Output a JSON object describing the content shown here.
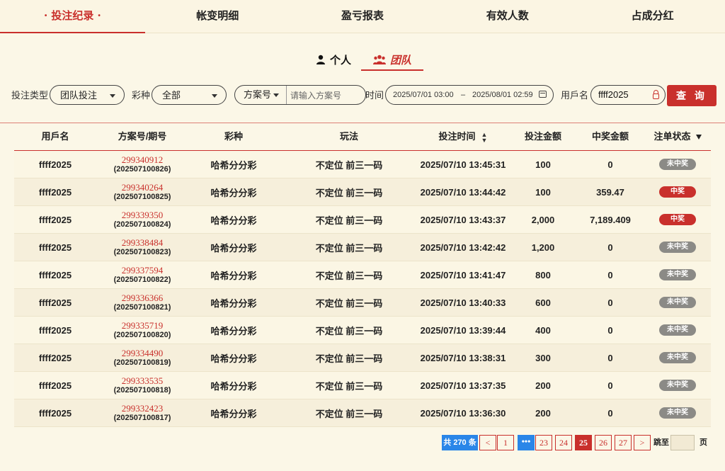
{
  "top_tabs": [
    {
      "label": "投注纪录",
      "active": true
    },
    {
      "label": "帐变明细"
    },
    {
      "label": "盈亏报表"
    },
    {
      "label": "有效人数"
    },
    {
      "label": "占成分红"
    }
  ],
  "sub_tabs": {
    "personal": "个人",
    "team": "团队"
  },
  "filters": {
    "bet_type_label": "投注类型",
    "bet_type_value": "团队投注",
    "lottery_label": "彩种",
    "lottery_value": "全部",
    "scheme_select": "方案号",
    "scheme_placeholder": "请输入方案号",
    "time_label": "时间",
    "date_start": "2025/07/01 03:00",
    "date_sep": "–",
    "date_end": "2025/08/01 02:59",
    "user_label": "用戶名",
    "user_value": "ffff2025",
    "query_button": "查 询"
  },
  "table": {
    "headers": [
      "用戶名",
      "方案号/期号",
      "彩种",
      "玩法",
      "投注时间",
      "投注金额",
      "中奖金额",
      "注单状态"
    ],
    "rows": [
      {
        "user": "ffff2025",
        "order": "299340912",
        "period": "(202507100826)",
        "lottery": "哈希分分彩",
        "play": "不定位 前三一码",
        "time": "2025/07/10 13:45:31",
        "bet": "100",
        "win": "0",
        "status": "未中奖"
      },
      {
        "user": "ffff2025",
        "order": "299340264",
        "period": "(202507100825)",
        "lottery": "哈希分分彩",
        "play": "不定位 前三一码",
        "time": "2025/07/10 13:44:42",
        "bet": "100",
        "win": "359.47",
        "status": "中奖"
      },
      {
        "user": "ffff2025",
        "order": "299339350",
        "period": "(202507100824)",
        "lottery": "哈希分分彩",
        "play": "不定位 前三一码",
        "time": "2025/07/10 13:43:37",
        "bet": "2,000",
        "win": "7,189.409",
        "status": "中奖"
      },
      {
        "user": "ffff2025",
        "order": "299338484",
        "period": "(202507100823)",
        "lottery": "哈希分分彩",
        "play": "不定位 前三一码",
        "time": "2025/07/10 13:42:42",
        "bet": "1,200",
        "win": "0",
        "status": "未中奖"
      },
      {
        "user": "ffff2025",
        "order": "299337594",
        "period": "(202507100822)",
        "lottery": "哈希分分彩",
        "play": "不定位 前三一码",
        "time": "2025/07/10 13:41:47",
        "bet": "800",
        "win": "0",
        "status": "未中奖"
      },
      {
        "user": "ffff2025",
        "order": "299336366",
        "period": "(202507100821)",
        "lottery": "哈希分分彩",
        "play": "不定位 前三一码",
        "time": "2025/07/10 13:40:33",
        "bet": "600",
        "win": "0",
        "status": "未中奖"
      },
      {
        "user": "ffff2025",
        "order": "299335719",
        "period": "(202507100820)",
        "lottery": "哈希分分彩",
        "play": "不定位 前三一码",
        "time": "2025/07/10 13:39:44",
        "bet": "400",
        "win": "0",
        "status": "未中奖"
      },
      {
        "user": "ffff2025",
        "order": "299334490",
        "period": "(202507100819)",
        "lottery": "哈希分分彩",
        "play": "不定位 前三一码",
        "time": "2025/07/10 13:38:31",
        "bet": "300",
        "win": "0",
        "status": "未中奖"
      },
      {
        "user": "ffff2025",
        "order": "299333535",
        "period": "(202507100818)",
        "lottery": "哈希分分彩",
        "play": "不定位 前三一码",
        "time": "2025/07/10 13:37:35",
        "bet": "200",
        "win": "0",
        "status": "未中奖"
      },
      {
        "user": "ffff2025",
        "order": "299332423",
        "period": "(202507100817)",
        "lottery": "哈希分分彩",
        "play": "不定位 前三一码",
        "time": "2025/07/10 13:36:30",
        "bet": "200",
        "win": "0",
        "status": "未中奖"
      }
    ]
  },
  "pagination": {
    "total": "共 270 条",
    "prev": "<",
    "first": "1",
    "ellipsis": "•••",
    "pages": [
      "23",
      "24",
      "25",
      "26",
      "27"
    ],
    "current": "25",
    "next": ">",
    "jump_label": "跳至",
    "page_suffix": "页"
  },
  "colors": {
    "accent": "#c9302c",
    "background": "#fbf7e7",
    "info_blue": "#2a86e8",
    "lose_badge": "#8b8a86"
  }
}
